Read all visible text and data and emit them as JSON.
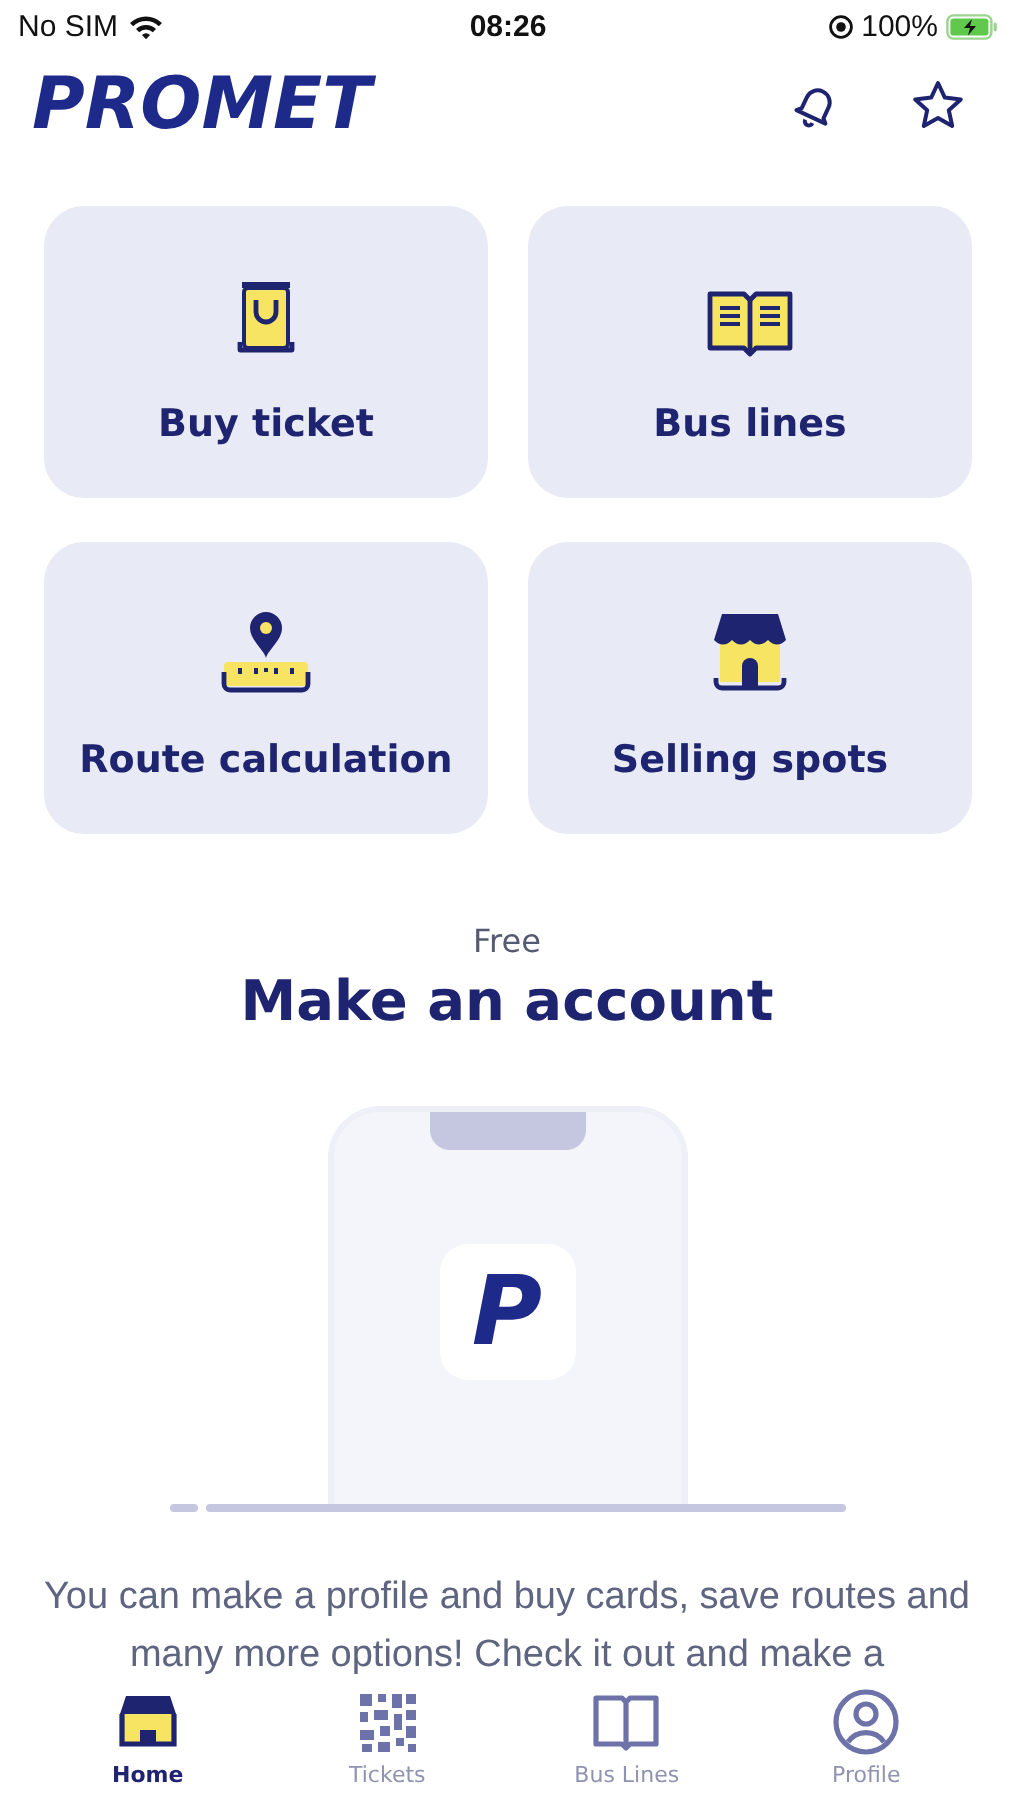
{
  "status_bar": {
    "carrier": "No SIM",
    "time": "08:26",
    "battery": "100%"
  },
  "header": {
    "logo": "PROMET"
  },
  "tiles": [
    {
      "label": "Buy ticket",
      "kind": "bag"
    },
    {
      "label": "Bus lines",
      "kind": "book"
    },
    {
      "label": "Route calculation",
      "kind": "route"
    },
    {
      "label": "Selling spots",
      "kind": "shop"
    }
  ],
  "promo": {
    "eyebrow": "Free",
    "title": "Make an account",
    "app_icon_letter": "P",
    "text": "You can make a profile and buy cards, save routes and many more options! Check it out and make a"
  },
  "tab_bar": [
    {
      "label": "Home",
      "kind": "home",
      "selected": true
    },
    {
      "label": "Tickets",
      "kind": "qr",
      "selected": false
    },
    {
      "label": "Bus Lines",
      "kind": "book",
      "selected": false
    },
    {
      "label": "Profile",
      "kind": "profile",
      "selected": false
    }
  ]
}
